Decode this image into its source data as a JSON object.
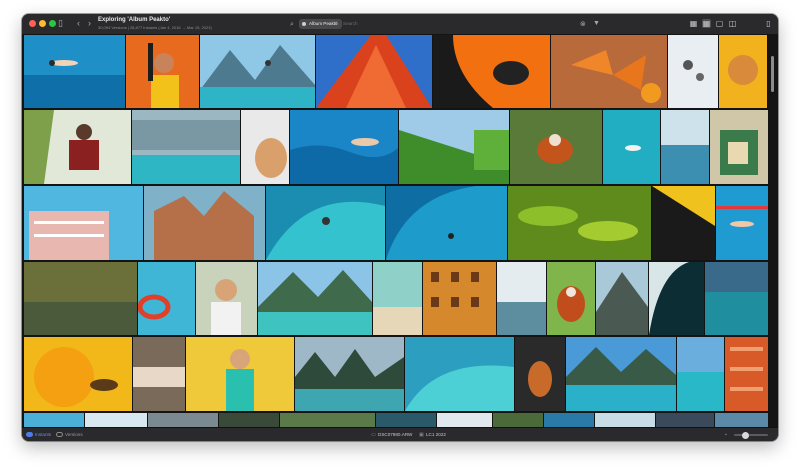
{
  "window": {
    "title": "Exploring 'Album Peakto'",
    "subtitle": "30,094 Versions | 28,877 Instants (Jan 4, 2016 → Mar 15, 2023)"
  },
  "search": {
    "chip_label": "Album Peakto",
    "placeholder": "Search"
  },
  "toolbar": {
    "icons": [
      "sidebar-icon",
      "back-icon",
      "forward-icon",
      "search-icon",
      "clear-icon",
      "filter-icon",
      "grid-small-icon",
      "grid-large-icon",
      "single-view-icon",
      "map-icon",
      "sidebar-right-icon"
    ]
  },
  "status": {
    "instants_label": "Instants",
    "versions_label": "Versions",
    "file_name": "DSC07980.ARW",
    "camera": "LC1 2022"
  },
  "colors": {
    "window_bg": "#1b1b1d",
    "titlebar": "#2a2a2c",
    "accent": "#4d7ce8"
  }
}
